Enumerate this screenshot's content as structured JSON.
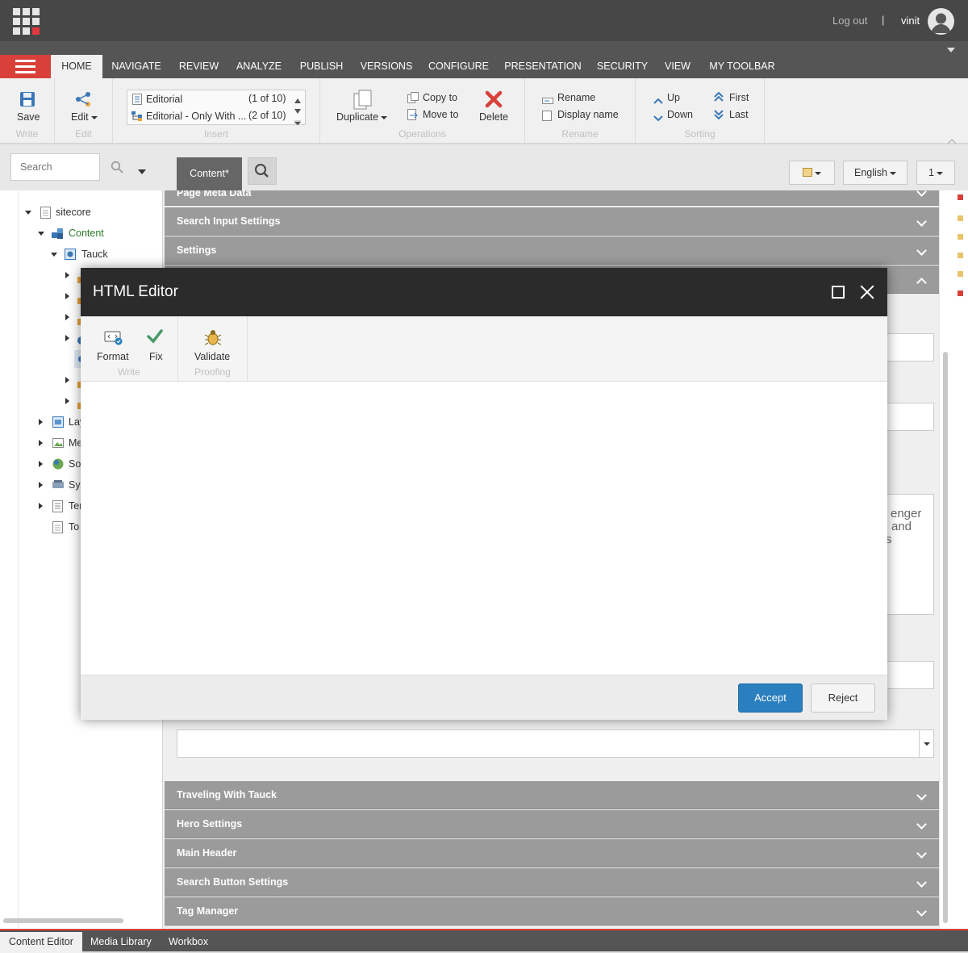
{
  "topbar": {
    "logout": "Log out",
    "separator": "|",
    "username": "vinit"
  },
  "tabs": [
    "HOME",
    "NAVIGATE",
    "REVIEW",
    "ANALYZE",
    "PUBLISH",
    "VERSIONS",
    "CONFIGURE",
    "PRESENTATION",
    "SECURITY",
    "VIEW",
    "MY TOOLBAR"
  ],
  "ribbon": {
    "save": "Save",
    "edit": "Edit",
    "write_group": "Write",
    "edit_group": "Edit",
    "editorial_1": "Editorial",
    "editorial_1_count": "(1 of 10)",
    "editorial_2": "Editorial - Only With ...",
    "editorial_2_count": "(2 of 10)",
    "insert_group": "Insert",
    "duplicate": "Duplicate",
    "copy_to": "Copy to",
    "move_to": "Move to",
    "delete": "Delete",
    "operations_group": "Operations",
    "rename": "Rename",
    "display_name": "Display name",
    "rename_group": "Rename",
    "up": "Up",
    "down": "Down",
    "first": "First",
    "last": "Last",
    "sorting_group": "Sorting"
  },
  "sidebar": {
    "search_placeholder": "Search",
    "tree": {
      "sitecore": "sitecore",
      "content": "Content",
      "tauck": "Tauck",
      "layout": "Lay",
      "media": "Me",
      "social": "Soc",
      "system": "Sys",
      "templates": "Ter",
      "todo": "To"
    }
  },
  "content_header": {
    "tab": "Content*",
    "language": "English",
    "version": "1"
  },
  "sections_top": [
    "Page Meta Data",
    "Search Input Settings",
    "Settings"
  ],
  "sections_bottom": [
    "Traveling With Tauck",
    "Hero Settings",
    "Main Header",
    "Search Button Settings",
    "Tag Manager"
  ],
  "background_text": [
    "enger",
    "and",
    "s"
  ],
  "dialog": {
    "title": "HTML Editor",
    "format": "Format",
    "fix": "Fix",
    "write_group": "Write",
    "validate": "Validate",
    "proofing_group": "Proofing",
    "accept": "Accept",
    "reject": "Reject"
  },
  "bottom_tabs": [
    "Content Editor",
    "Media Library",
    "Workbox"
  ],
  "colors": {
    "accent_red": "#d9403a",
    "accept_blue": "#2a7fbf",
    "dark_header": "#2b2b2b"
  }
}
